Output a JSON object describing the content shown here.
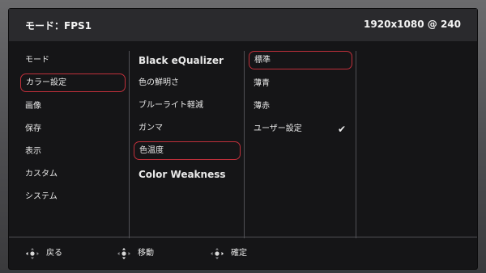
{
  "header": {
    "mode_title": "モード：FPS1",
    "resolution": "1920x1080 @ 240"
  },
  "main_menu": {
    "items": [
      {
        "label": "モード",
        "selected": false
      },
      {
        "label": "カラー設定",
        "selected": true
      },
      {
        "label": "画像",
        "selected": false
      },
      {
        "label": "保存",
        "selected": false
      },
      {
        "label": "表示",
        "selected": false
      },
      {
        "label": "カスタム",
        "selected": false
      },
      {
        "label": "システム",
        "selected": false
      }
    ]
  },
  "color_menu": {
    "items": [
      {
        "label": "Black eQualizer",
        "selected": false
      },
      {
        "label": "色の鮮明さ",
        "selected": false
      },
      {
        "label": "ブルーライト軽減",
        "selected": false
      },
      {
        "label": "ガンマ",
        "selected": false
      },
      {
        "label": "色温度",
        "selected": true
      },
      {
        "label": "Color Weakness",
        "selected": false
      }
    ]
  },
  "color_temp_menu": {
    "items": [
      {
        "label": "標準",
        "selected": true,
        "checked": false
      },
      {
        "label": "薄青",
        "selected": false,
        "checked": false
      },
      {
        "label": "薄赤",
        "selected": false,
        "checked": false
      },
      {
        "label": "ユーザー設定",
        "selected": false,
        "checked": true
      }
    ],
    "check_mark": "✔"
  },
  "footer": {
    "back_label": "戻る",
    "move_label": "移動",
    "confirm_label": "確定"
  },
  "colors": {
    "accent": "#c0303b",
    "background": "#151517",
    "header": "#2a2a2d"
  }
}
